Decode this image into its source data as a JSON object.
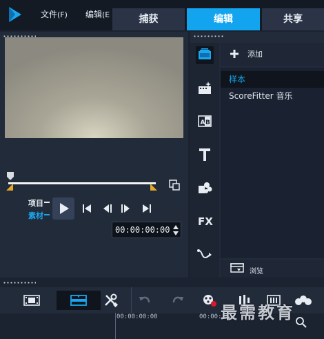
{
  "menubar": {
    "file": "文件",
    "file_key": "(F)",
    "edit": "编辑",
    "edit_key": "(E"
  },
  "tabs": [
    {
      "label": "捕获",
      "active": false
    },
    {
      "label": "编辑",
      "active": true
    },
    {
      "label": "共享",
      "active": false
    }
  ],
  "player": {
    "mode_project": "项目",
    "mode_clip": "素材",
    "timecode": "00:00:00:00",
    "selected_mode": "素材"
  },
  "library": {
    "add_label": "添加",
    "items": [
      {
        "label": "样本",
        "selected": true
      },
      {
        "label": "ScoreFitter 音乐",
        "selected": false
      }
    ],
    "browse_label": "浏览",
    "side_icons": [
      "media-icon",
      "instant-project-icon",
      "transition-icon",
      "title-icon",
      "graphics-icon",
      "fx-icon",
      "path-icon"
    ]
  },
  "timeline": {
    "ruler_start": "00:00:00:00",
    "ruler_next": "00:00:",
    "watermark": "最需教育"
  },
  "colors": {
    "accent": "#13a4f0",
    "panel": "#222b3a",
    "background": "#1b2230",
    "trim_marker": "#e4a829"
  }
}
